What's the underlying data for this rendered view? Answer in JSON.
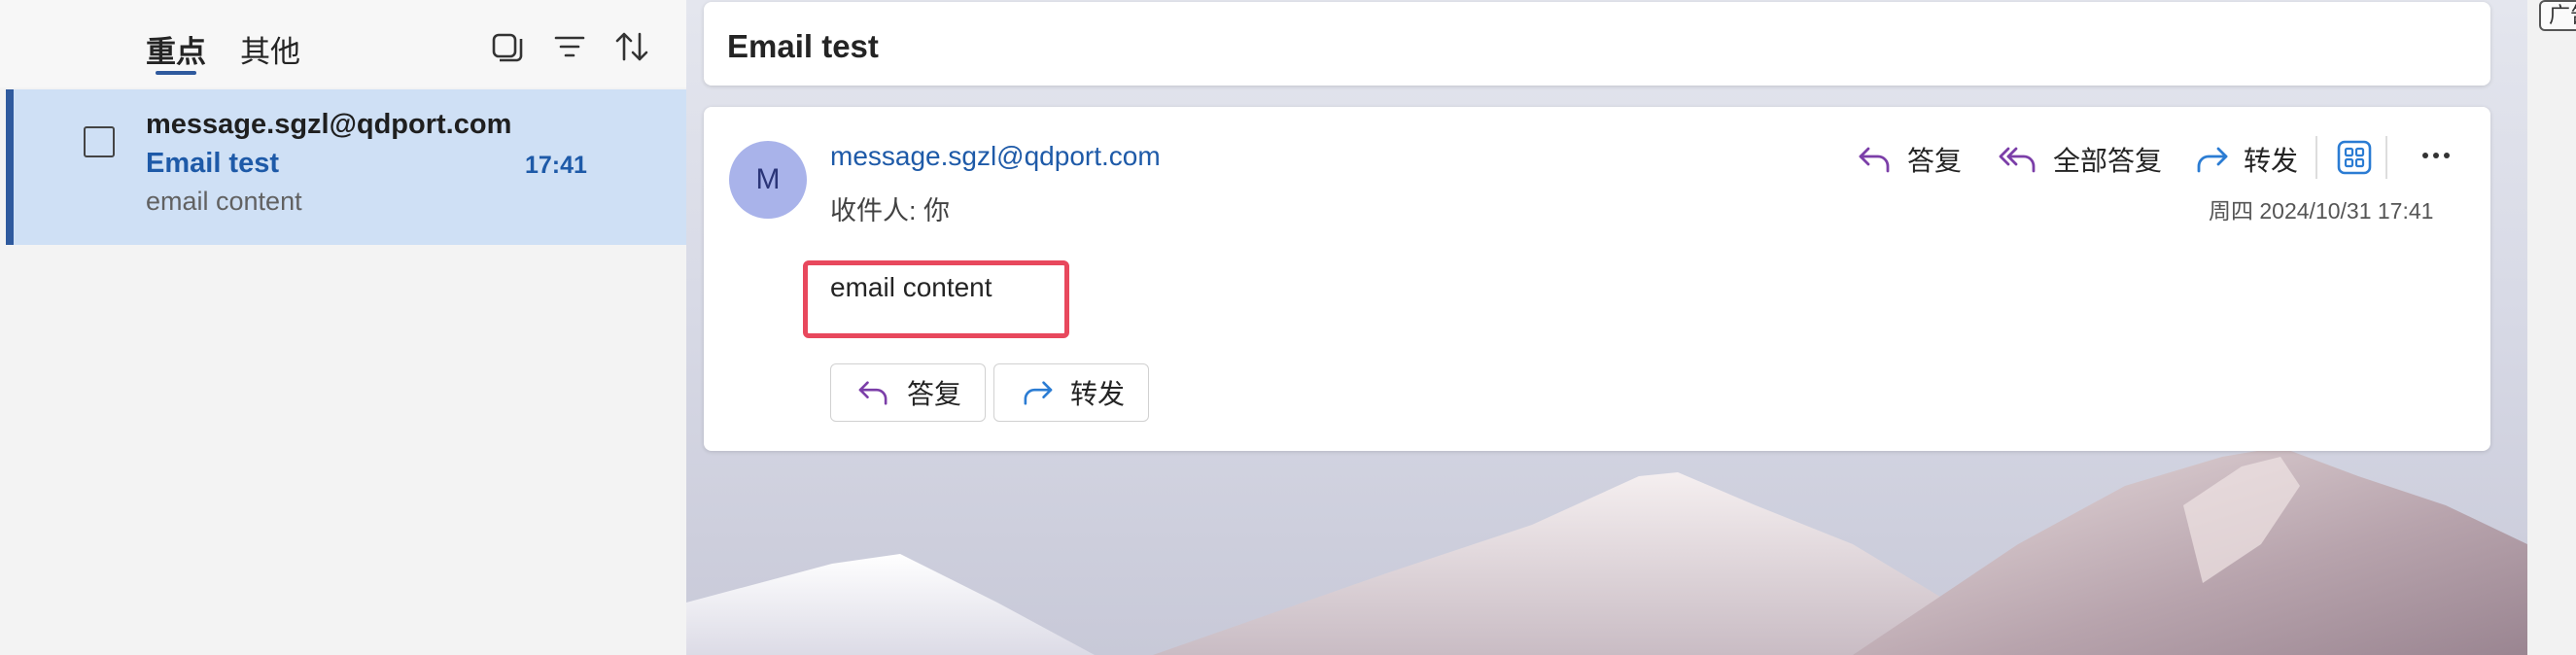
{
  "list": {
    "tabs": {
      "focused": "重点",
      "other": "其他"
    },
    "messages": [
      {
        "sender": "message.sgzl@qdport.com",
        "subject": "Email test",
        "time": "17:41",
        "preview": "email content"
      }
    ]
  },
  "reading": {
    "subject": "Email test",
    "avatar_initial": "M",
    "sender": "message.sgzl@qdport.com",
    "to_line": "收件人: 你",
    "date": "周四 2024/10/31 17:41",
    "body": "email content",
    "actions": {
      "reply": "答复",
      "reply_all": "全部答复",
      "forward": "转发"
    },
    "buttons": {
      "reply": "答复",
      "forward": "转发"
    }
  },
  "ad_label": "广告",
  "colors": {
    "accent": "#2f5a9e",
    "selected_bg": "#cfe0f5",
    "highlight": "#e8485d",
    "avatar": "#a9b3ea"
  }
}
